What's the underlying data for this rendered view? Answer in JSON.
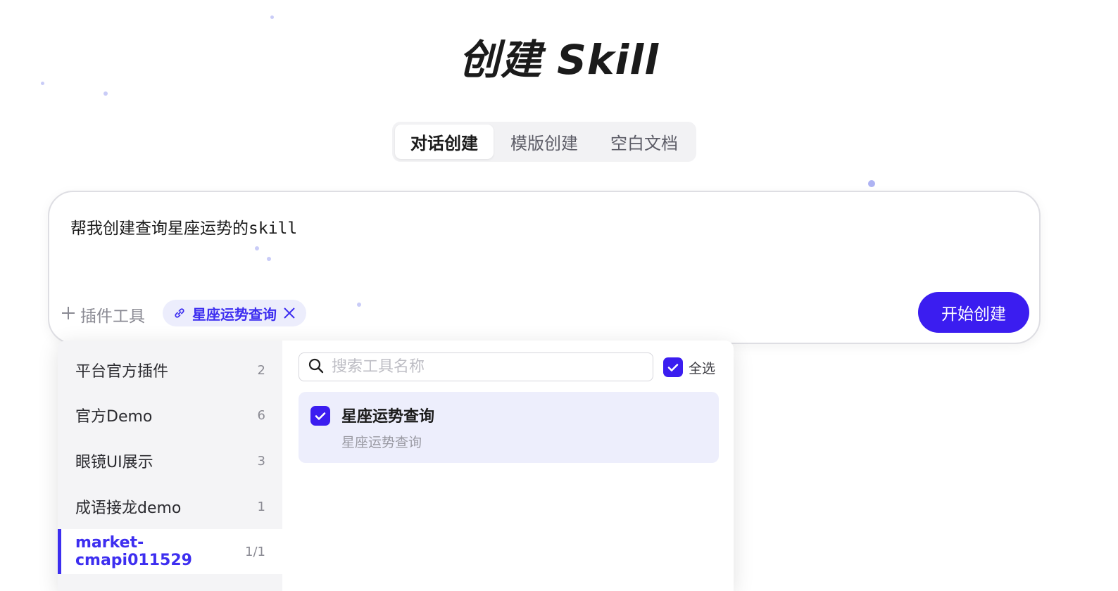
{
  "page": {
    "title": "创建 Skill"
  },
  "tabs": [
    {
      "label": "对话创建",
      "active": true
    },
    {
      "label": "模版创建",
      "active": false
    },
    {
      "label": "空白文档",
      "active": false
    }
  ],
  "composer": {
    "prompt_text": "帮我创建查询星座运势的skill",
    "plugin_tools_label": "插件工具",
    "selected_chip": "星座运势查询",
    "start_button": "开始创建"
  },
  "plugin_panel": {
    "categories": [
      {
        "name": "平台官方插件",
        "count": "2"
      },
      {
        "name": "官方Demo",
        "count": "6"
      },
      {
        "name": "眼镜UI展示",
        "count": "3"
      },
      {
        "name": "成语接龙demo",
        "count": "1"
      },
      {
        "name": "market-cmapi011529",
        "count": "1/1",
        "active": true
      }
    ],
    "search_placeholder": "搜索工具名称",
    "select_all_label": "全选",
    "select_all_checked": true,
    "tools": [
      {
        "name": "星座运势查询",
        "description": "星座运势查询",
        "checked": true
      }
    ]
  },
  "colors": {
    "accent": "#3b1df0",
    "chip_bg": "#ecedfc",
    "selected_item_bg": "#edeefc"
  },
  "icons": [
    "plus-icon",
    "link-icon",
    "close-icon",
    "search-icon",
    "checkmark-icon"
  ]
}
